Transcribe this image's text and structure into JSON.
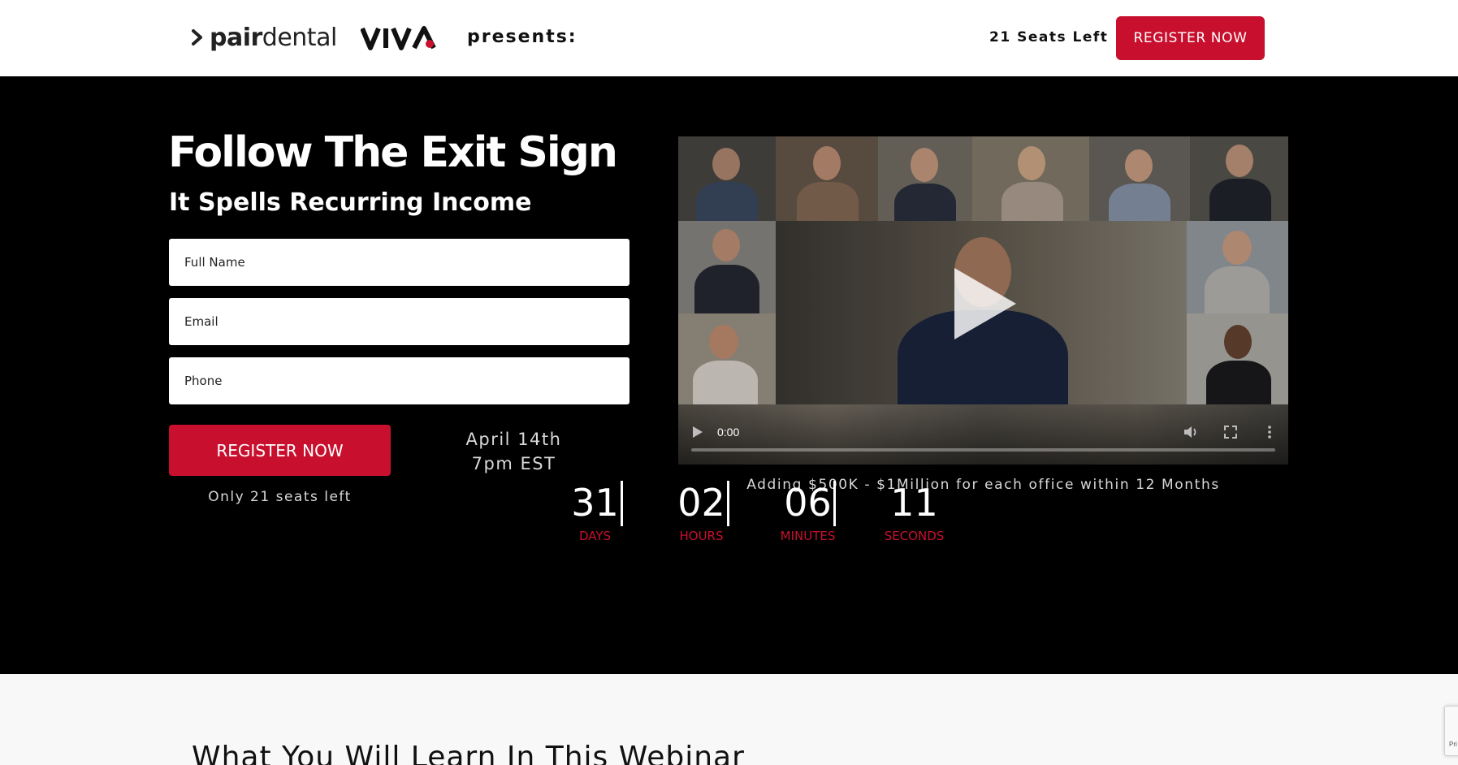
{
  "header": {
    "logo_pair_bold": "pair",
    "logo_pair_light": "dental",
    "logo_viva_text": "VIVA",
    "presents": "presents:",
    "seats_left": "21 Seats Left",
    "register_label": "REGISTER NOW"
  },
  "hero": {
    "title": "Follow The Exit Sign",
    "subtitle": "It Spells Recurring Income",
    "form": {
      "full_name_placeholder": "Full Name",
      "email_placeholder": "Email",
      "phone_placeholder": "Phone",
      "register_label": "REGISTER NOW",
      "seats_note": "Only 21 seats left"
    },
    "event_date_line1": "April 14th",
    "event_date_line2": "7pm EST"
  },
  "video": {
    "current_time": "0:00",
    "progress": 0,
    "caption": "Adding $500K - $1Million for each office within 12 Months"
  },
  "countdown": [
    {
      "value": "31",
      "label": "DAYS"
    },
    {
      "value": "02",
      "label": "HOURS"
    },
    {
      "value": "06",
      "label": "MINUTES"
    },
    {
      "value": "11",
      "label": "SECONDS"
    }
  ],
  "section2": {
    "title": "What You Will Learn In This Webinar"
  },
  "recaptcha": {
    "text": "Pri"
  },
  "colors": {
    "brand_red": "#c8102e",
    "hero_bg": "#000000",
    "section_bg": "#f8f8f8"
  },
  "icons": [
    "pair-chevron-icon",
    "viva-logo-icon",
    "play-icon",
    "volume-icon",
    "fullscreen-icon",
    "more-icon"
  ]
}
